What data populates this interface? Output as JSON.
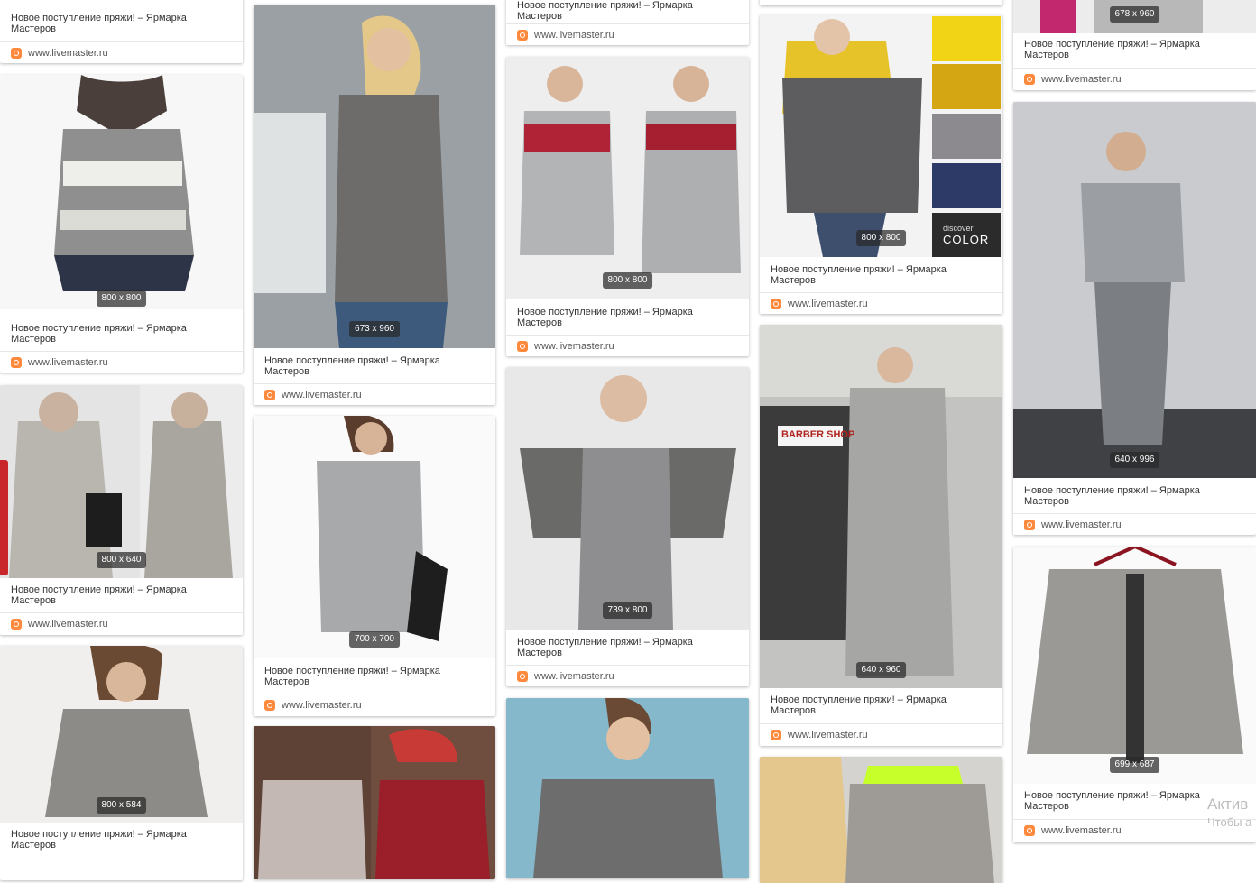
{
  "pin": {
    "title": "Новое поступление пряжи! – Ярмарка Мастеров",
    "source": "www.livemaster.ru"
  },
  "dimensions": {
    "d800x800": "800 x 800",
    "d673x960": "673 x 960",
    "d800x640": "800 x 640",
    "d700x700": "700 x 700",
    "d739x800": "739 x 800",
    "d640x960": "640 x 960",
    "d678x960": "678 x 960",
    "d640x996": "640 x 996",
    "d699x687": "699 x 687",
    "d800x584": "800 x 584"
  },
  "palette_card": {
    "label_small": "discover",
    "label_big": "COLOR",
    "swatches": [
      "#f2d417",
      "#d4a614",
      "#8c8a8f",
      "#2d3a68",
      "#2b2b2b"
    ]
  },
  "street_sign": "BARBER SHOP",
  "watermark": {
    "line1": "Актив",
    "line2": "Чтобы а"
  },
  "colors": {
    "accent_favicon": "#ff8a3d",
    "side_tab": "#c8262a"
  }
}
